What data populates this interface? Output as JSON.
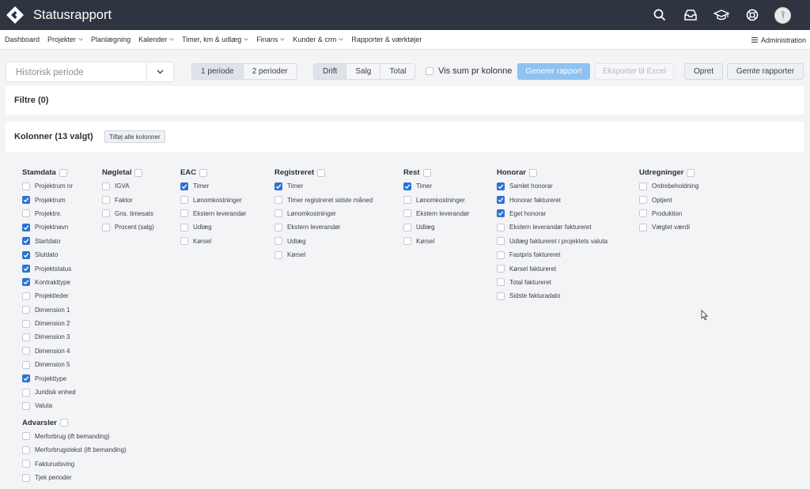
{
  "app": {
    "title": "Statusrapport"
  },
  "topbar": {
    "icons": [
      "search-icon",
      "inbox-icon",
      "graduation-cap-icon",
      "lifebuoy-icon"
    ]
  },
  "nav": {
    "items": [
      {
        "label": "Dashboard",
        "dropdown": false
      },
      {
        "label": "Projekter",
        "dropdown": true
      },
      {
        "label": "Planlægning",
        "dropdown": false
      },
      {
        "label": "Kalender",
        "dropdown": true
      },
      {
        "label": "Timer, km & udlæg",
        "dropdown": true
      },
      {
        "label": "Finans",
        "dropdown": true
      },
      {
        "label": "Kunder & crm",
        "dropdown": true
      },
      {
        "label": "Rapporter & værktøjer",
        "dropdown": false
      }
    ],
    "admin_label": "Administration"
  },
  "toolbar": {
    "period_placeholder": "Historisk periode",
    "period_buttons": [
      {
        "label": "1 periode",
        "active": true
      },
      {
        "label": "2 perioder",
        "active": false
      }
    ],
    "view_buttons": [
      {
        "label": "Drift",
        "active": true
      },
      {
        "label": "Salg",
        "active": false
      },
      {
        "label": "Total",
        "active": false
      }
    ],
    "sum_label": "Vis sum pr kolonne",
    "generate_label": "Generer rapport",
    "export_label": "Eksporter til Excel",
    "create_label": "Opret",
    "saved_label": "Gemte rapporter"
  },
  "filters": {
    "title": "Filtre (0)"
  },
  "columns": {
    "title": "Kolonner (13 valgt)",
    "add_all_label": "Tilføj alle kolonner"
  },
  "colors": {
    "topbar": "#2e3440",
    "accent": "#2a73d6",
    "primary_button": "#8fc2f0"
  },
  "column_groups": [
    {
      "groups": [
        {
          "name": "Stamdata",
          "items": [
            {
              "label": "Projektrum nr",
              "checked": false
            },
            {
              "label": "Projektrum",
              "checked": true
            },
            {
              "label": "Projektnr.",
              "checked": false
            },
            {
              "label": "Projektnavn",
              "checked": true
            },
            {
              "label": "Startdato",
              "checked": true
            },
            {
              "label": "Slutdato",
              "checked": true
            },
            {
              "label": "Projektstatus",
              "checked": true
            },
            {
              "label": "Kontrakttype",
              "checked": true
            },
            {
              "label": "Projektleder",
              "checked": false
            },
            {
              "label": "Dimension 1",
              "checked": false
            },
            {
              "label": "Dimension 2",
              "checked": false
            },
            {
              "label": "Dimension 3",
              "checked": false
            },
            {
              "label": "Dimension 4",
              "checked": false
            },
            {
              "label": "Dimension 5",
              "checked": false
            },
            {
              "label": "Projekttype",
              "checked": true
            },
            {
              "label": "Juridisk enhed",
              "checked": false
            },
            {
              "label": "Valuta",
              "checked": false
            }
          ]
        },
        {
          "name": "Advarsler",
          "items": [
            {
              "label": "Merforbrug (ift bemanding)",
              "checked": false
            },
            {
              "label": "Merforbrugstekst (ift bemanding)",
              "checked": false
            },
            {
              "label": "Fakturudsving",
              "checked": false
            },
            {
              "label": "Tjek perioder",
              "checked": false
            }
          ]
        }
      ]
    },
    {
      "groups": [
        {
          "name": "Nøgletal",
          "items": [
            {
              "label": "IGVA",
              "checked": false
            },
            {
              "label": "Faktor",
              "checked": false
            },
            {
              "label": "Gns. timesats",
              "checked": false
            },
            {
              "label": "Procent (salg)",
              "checked": false
            }
          ]
        }
      ]
    },
    {
      "groups": [
        {
          "name": "EAC",
          "items": [
            {
              "label": "Timer",
              "checked": true
            },
            {
              "label": "Lønomkostninger",
              "checked": false
            },
            {
              "label": "Ekstern leverandør",
              "checked": false
            },
            {
              "label": "Udlæg",
              "checked": false
            },
            {
              "label": "Kørsel",
              "checked": false
            }
          ]
        }
      ]
    },
    {
      "groups": [
        {
          "name": "Registreret",
          "items": [
            {
              "label": "Timer",
              "checked": true
            },
            {
              "label": "Timer registreret sidste måned",
              "checked": false
            },
            {
              "label": "Lønomkostninger",
              "checked": false
            },
            {
              "label": "Ekstern leverandør",
              "checked": false
            },
            {
              "label": "Udlæg",
              "checked": false
            },
            {
              "label": "Kørsel",
              "checked": false
            }
          ]
        }
      ]
    },
    {
      "groups": [
        {
          "name": "Rest",
          "items": [
            {
              "label": "Timer",
              "checked": true
            },
            {
              "label": "Lønomkostninger",
              "checked": false
            },
            {
              "label": "Ekstern leverandør",
              "checked": false
            },
            {
              "label": "Udlæg",
              "checked": false
            },
            {
              "label": "Kørsel",
              "checked": false
            }
          ]
        }
      ]
    },
    {
      "groups": [
        {
          "name": "Honorar",
          "items": [
            {
              "label": "Samlet honorar",
              "checked": true
            },
            {
              "label": "Honorar faktureret",
              "checked": true
            },
            {
              "label": "Eget honorar",
              "checked": true
            },
            {
              "label": "Ekstern leverandør faktureret",
              "checked": false
            },
            {
              "label": "Udlæg faktureret i projektets valuta",
              "checked": false
            },
            {
              "label": "Fastpris faktureret",
              "checked": false
            },
            {
              "label": "Kørsel faktureret",
              "checked": false
            },
            {
              "label": "Total faktureret",
              "checked": false
            },
            {
              "label": "Sidste fakturadato",
              "checked": false
            }
          ]
        }
      ]
    },
    {
      "groups": [
        {
          "name": "Udregninger",
          "items": [
            {
              "label": "Ordrebeholdning",
              "checked": false
            },
            {
              "label": "Optjent",
              "checked": false
            },
            {
              "label": "Produktion",
              "checked": false
            },
            {
              "label": "Vægtet værdi",
              "checked": false
            }
          ]
        }
      ]
    }
  ]
}
